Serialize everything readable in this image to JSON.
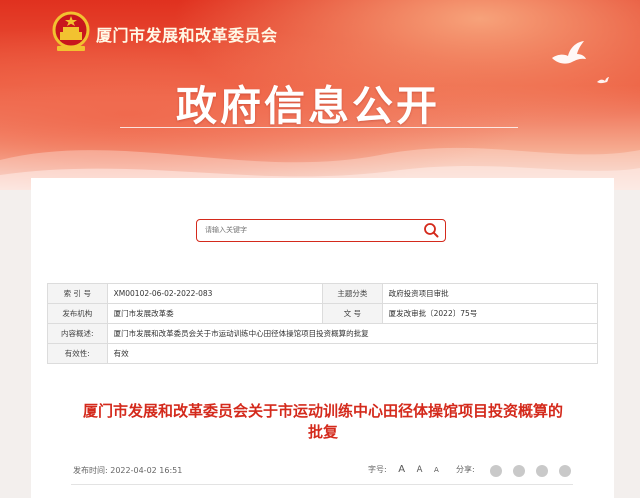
{
  "header": {
    "org_name": "厦门市发展和改革委员会",
    "title": "政府信息公开",
    "theme_color": "#e0311f"
  },
  "search": {
    "placeholder": "请输入关键字",
    "icon": "search-icon"
  },
  "meta": {
    "rows": [
      [
        {
          "label": "索 引 号",
          "value": "XM00102-06-02-2022-083"
        },
        {
          "label": "主题分类",
          "value": "政府投资项目审批"
        }
      ],
      [
        {
          "label": "发布机构",
          "value": "厦门市发展改革委"
        },
        {
          "label": "文 号",
          "value": "厦发改审批〔2022〕75号"
        }
      ]
    ],
    "summary_label": "内容概述:",
    "summary_value": "厦门市发展和改革委员会关于市运动训练中心田径体操馆项目投资概算的批复",
    "validity_label": "有效性:",
    "validity_value": "有效"
  },
  "article": {
    "title_line1": "厦门市发展和改革委员会关于市运动训练中心田径体操馆项目投资概算的",
    "title_line2": "批复",
    "title_color": "#d42a1c",
    "publish_label": "发布时间:",
    "publish_date": "2022-04-02 16:51",
    "fontsize_label": "字号:",
    "fontsize_options": [
      "A",
      "A",
      "A"
    ],
    "share_label": "分享:",
    "share_icons": [
      "wechat-icon",
      "weibo-icon",
      "qq-icon",
      "qzone-icon"
    ]
  }
}
